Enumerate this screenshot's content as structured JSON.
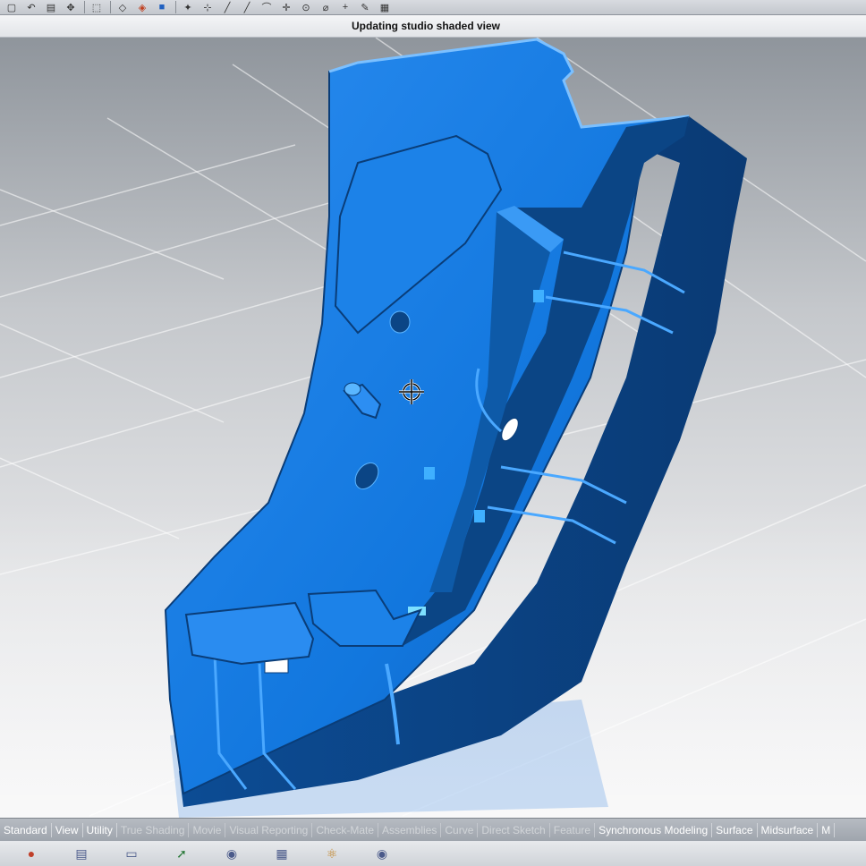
{
  "toolbar": {
    "icons": [
      "fit-icon",
      "undo-icon",
      "part-icon",
      "move-icon",
      "select-box-icon",
      "wireframe-icon",
      "shaded-icon",
      "studio-shaded-icon",
      "snap-icon",
      "point-icon",
      "line-icon",
      "arc-icon",
      "cross-icon",
      "circle-snap-icon",
      "polygon-icon",
      "plus-icon",
      "pen-icon",
      "tag-icon",
      "grid-icon"
    ]
  },
  "status": {
    "text": "Updating studio shaded view"
  },
  "viewport": {
    "part_color": "#1479e0",
    "part_shadow_color": "#0a3d78",
    "cursor": "crosshair-cursor"
  },
  "tabs": [
    {
      "label": "Standard",
      "dim": false
    },
    {
      "label": "View",
      "dim": false
    },
    {
      "label": "Utility",
      "dim": false
    },
    {
      "label": "True Shading",
      "dim": true
    },
    {
      "label": "Movie",
      "dim": true
    },
    {
      "label": "Visual Reporting",
      "dim": true
    },
    {
      "label": "Check-Mate",
      "dim": true
    },
    {
      "label": "Assemblies",
      "dim": true
    },
    {
      "label": "Curve",
      "dim": true
    },
    {
      "label": "Direct Sketch",
      "dim": true
    },
    {
      "label": "Feature",
      "dim": true
    },
    {
      "label": "Synchronous Modeling",
      "dim": false
    },
    {
      "label": "Surface",
      "dim": false
    },
    {
      "label": "Midsurface",
      "dim": false
    },
    {
      "label": "M",
      "dim": false
    }
  ],
  "ribbon": {
    "icons": [
      "render-icon",
      "table-icon",
      "blank-icon",
      "arrow-icon",
      "blank-icon",
      "grid-icon",
      "network-icon",
      "sphere-icon"
    ]
  }
}
